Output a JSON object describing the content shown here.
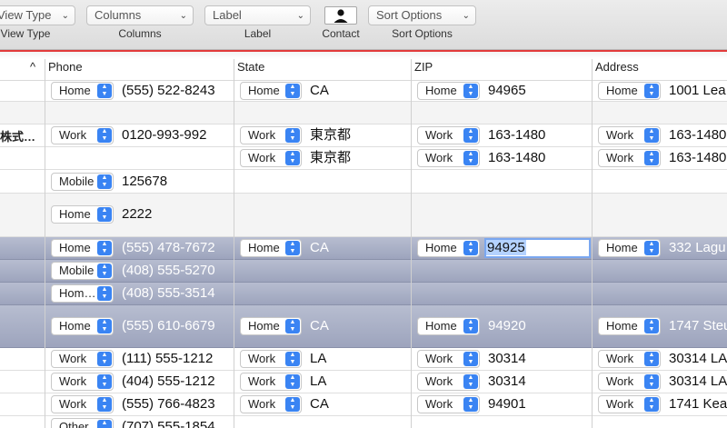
{
  "toolbar": {
    "view_type": {
      "value": "View Type",
      "label": "View Type"
    },
    "columns": {
      "value": "Columns",
      "label": "Columns"
    },
    "label": {
      "value": "Label",
      "label": "Label"
    },
    "contact": {
      "label": "Contact"
    },
    "sort": {
      "value": "Sort Options",
      "label": "Sort Options"
    }
  },
  "columns": {
    "sort_indicator": "^",
    "phone": "Phone",
    "state": "State",
    "zip": "ZIP",
    "address": "Address"
  },
  "rows": [
    {
      "phone_label": "Home",
      "phone": "(555) 522-8243",
      "state_label": "Home",
      "state": "CA",
      "zip_label": "Home",
      "zip": "94965",
      "addr_label": "Home",
      "addr": "1001 Lea"
    },
    {
      "name": "株式…",
      "phone_label": "Work",
      "phone": "0120-993-992",
      "state_label": "Work",
      "state": "東京都",
      "zip_label": "Work",
      "zip": "163-1480",
      "addr_label": "Work",
      "addr": "163-1480"
    },
    {
      "state_label": "Work",
      "state": "東京都",
      "zip_label": "Work",
      "zip": "163-1480",
      "addr_label": "Work",
      "addr": "163-1480"
    },
    {
      "phone_label": "Mobile",
      "phone": "125678"
    },
    {
      "phone_label": "Home",
      "phone": "2222"
    },
    {
      "phone_label": "Home",
      "phone": "(555) 478-7672",
      "state_label": "Home",
      "state": "CA",
      "zip_label": "Home",
      "zip": "94925",
      "addr_label": "Home",
      "addr": "332 Lagu"
    },
    {
      "phone_label": "Mobile",
      "phone": "(408) 555-5270"
    },
    {
      "phone_label": "Hom…",
      "phone": "(408) 555-3514"
    },
    {
      "phone_label": "Home",
      "phone": "(555) 610-6679",
      "state_label": "Home",
      "state": "CA",
      "zip_label": "Home",
      "zip": "94920",
      "addr_label": "Home",
      "addr": "1747 Steu"
    },
    {
      "phone_label": "Work",
      "phone": "(111) 555-1212",
      "state_label": "Work",
      "state": "LA",
      "zip_label": "Work",
      "zip": "30314",
      "addr_label": "Work",
      "addr": "30314 LA"
    },
    {
      "phone_label": "Work",
      "phone": "(404) 555-1212",
      "state_label": "Work",
      "state": "LA",
      "zip_label": "Work",
      "zip": "30314",
      "addr_label": "Work",
      "addr": "30314 LA"
    },
    {
      "phone_label": "Work",
      "phone": "(555) 766-4823",
      "state_label": "Work",
      "state": "CA",
      "zip_label": "Work",
      "zip": "94901",
      "addr_label": "Work",
      "addr": "1741 Kear"
    },
    {
      "phone_label": "Other",
      "phone": "(707) 555-1854"
    }
  ]
}
